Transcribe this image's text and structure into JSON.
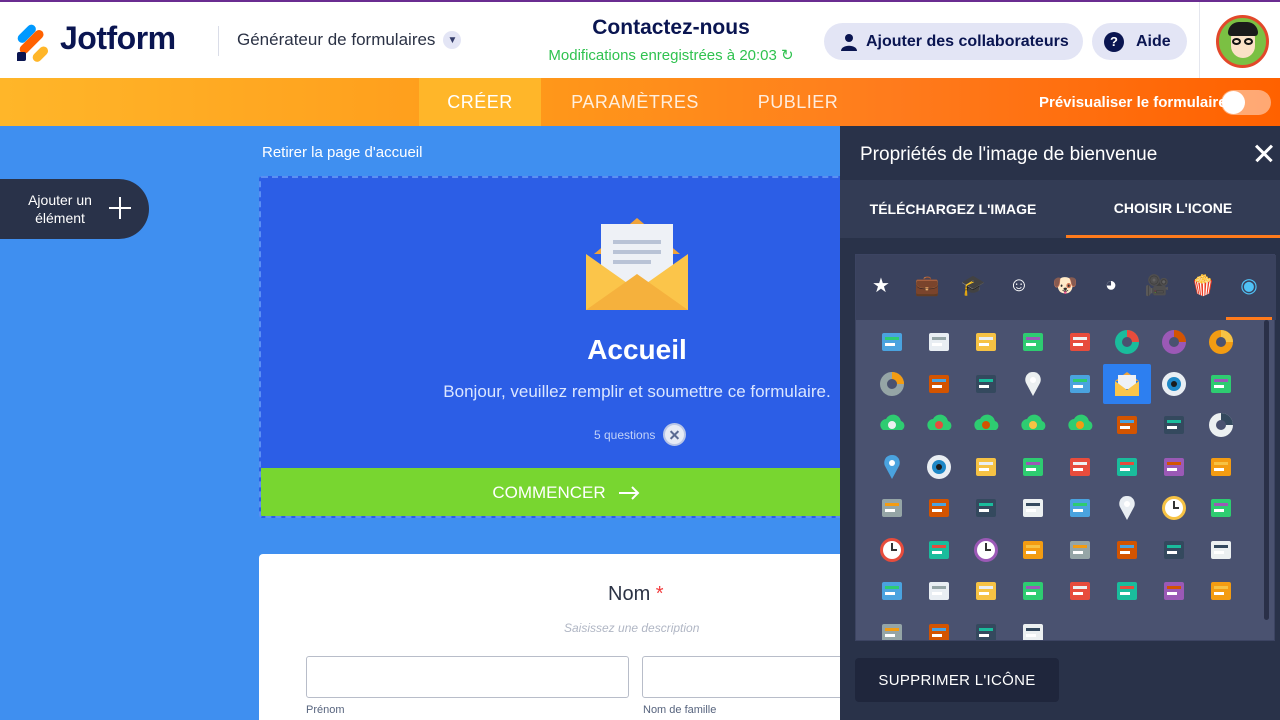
{
  "header": {
    "logo_text": "Jotform",
    "generator_label": "Générateur de formulaires",
    "form_title": "Contactez-nous",
    "saved_status": "Modifications enregistrées à 20:03",
    "collaborators_button": "Ajouter des collaborateurs",
    "help_button": "Aide"
  },
  "nav": {
    "tabs": [
      {
        "label": "CRÉER",
        "active": true
      },
      {
        "label": "PARAMÈTRES",
        "active": false
      },
      {
        "label": "PUBLIER",
        "active": false
      }
    ],
    "preview_label": "Prévisualiser le formulaire",
    "preview_enabled": false
  },
  "canvas": {
    "add_element_label": "Ajouter un élément",
    "remove_welcome": "Retirer la page d'accueil",
    "welcome": {
      "title": "Accueil",
      "subtitle": "Bonjour, veuillez remplir et soumettre ce formulaire.",
      "questions": "5 questions",
      "start_button": "COMMENCER"
    },
    "field": {
      "label": "Nom",
      "required_mark": "*",
      "description": "Saisissez une description",
      "first_name_sublabel": "Prénom",
      "last_name_sublabel": "Nom de famille"
    }
  },
  "panel": {
    "title": "Propriétés de l'image de bienvenue",
    "tabs": [
      {
        "label": "TÉLÉCHARGEZ L'IMAGE",
        "active": false
      },
      {
        "label": "CHOISIR L'ICONE",
        "active": true
      }
    ],
    "categories": [
      {
        "name": "star-icon",
        "glyph": "★"
      },
      {
        "name": "briefcase-icon",
        "glyph": "💼"
      },
      {
        "name": "graduation-cap-icon",
        "glyph": "🎓"
      },
      {
        "name": "smiley-icon",
        "glyph": "☺"
      },
      {
        "name": "dog-icon",
        "glyph": "🐶"
      },
      {
        "name": "pacman-icon",
        "glyph": "◕"
      },
      {
        "name": "camera-icon",
        "glyph": "🎥"
      },
      {
        "name": "popcorn-icon",
        "glyph": "🍿"
      },
      {
        "name": "eye-icon",
        "glyph": "◉",
        "active": true
      }
    ],
    "icons": [
      [
        "id-card-icon",
        "bank-icon",
        "presentation-icon",
        "briefcase-icon",
        "buildings-icon",
        "chart-up-icon",
        "pie-chart-icon",
        "donut-chart-icon"
      ],
      [
        "laptop-chart-icon",
        "money-icon",
        "price-tag-icon",
        "map-pin-icon",
        "map-icon",
        "envelope-open-icon",
        "camera-lens-icon",
        "hard-drive-icon"
      ],
      [
        "cloud-check-icon",
        "cloud-download-icon",
        "cloud-error-icon",
        "cloud-sync-icon",
        "cloud-upload-icon",
        "certificate-icon",
        "notepad-icon",
        "donut-icon"
      ],
      [
        "water-drop-icon",
        "eye-icon",
        "foam-finger-icon",
        "burger-icon",
        "hotdog-icon",
        "muffin-icon",
        "pizza-icon",
        "speaker-icon"
      ],
      [
        "yin-yang-icon",
        "board-icon",
        "books-icon",
        "office-chair-icon",
        "target-icon",
        "pushpin-icon",
        "clock-check-icon",
        "calculator-icon"
      ],
      [
        "alarm-clock-icon",
        "light-bulb-icon",
        "stopwatch-icon",
        "column-icon",
        "school-bag-icon",
        "backpack-icon",
        "barcode-receipt-icon",
        "handbag-icon"
      ],
      [
        "worker-icon",
        "swiss-knife-icon",
        "first-aid-kit-icon",
        "coupon-icon",
        "store-icon",
        "toaster-icon",
        "radio-icon",
        "bus-icon"
      ],
      [
        "train-icon",
        "rocket-icon",
        "tram-icon",
        "flag-icon"
      ]
    ],
    "selected_icon": "envelope-open-icon",
    "remove_icon_button": "SUPPRIMER L'ICÔNE"
  },
  "colors": {
    "brand_navy": "#0a1551",
    "canvas_blue": "#3f8ff0",
    "welcome_blue": "#2c5ee6",
    "start_green": "#78d630",
    "accent_orange": "#ff7b1c",
    "panel_dark": "#293249",
    "saved_green": "#2fc24f"
  }
}
